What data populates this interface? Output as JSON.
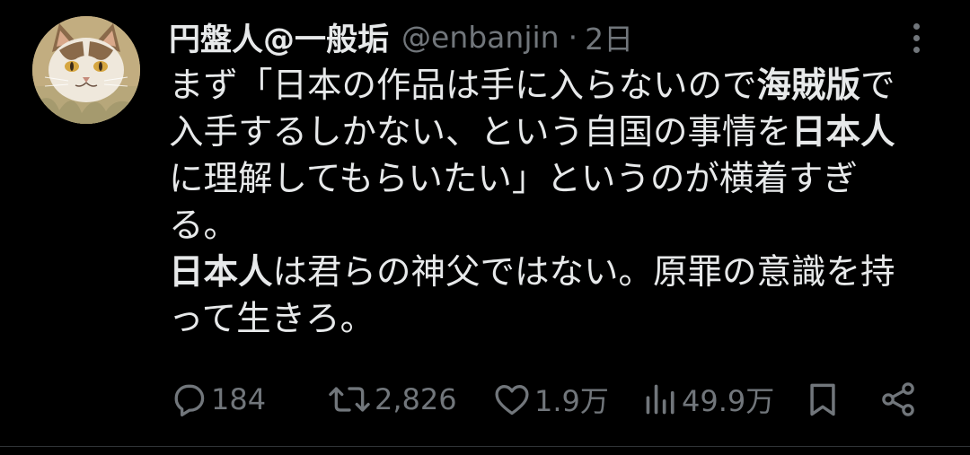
{
  "author": {
    "display_name": "円盤人@一般垢",
    "handle": "@enbanjin",
    "separator": "·",
    "time": "2日",
    "avatar_icon": "cat-avatar-icon"
  },
  "tweet": {
    "lines": [
      [
        {
          "text": "まず「日本の作品は手に入らないので",
          "bold": false
        },
        {
          "text": "海賊版",
          "bold": true
        },
        {
          "text": "で",
          "bold": false
        }
      ],
      [
        {
          "text": "入手するしかない、という自国の事情を",
          "bold": false
        },
        {
          "text": "日本人",
          "bold": true
        }
      ],
      [
        {
          "text": "に理解してもらいたい」というのが横着すぎ",
          "bold": false
        }
      ],
      [
        {
          "text": "る。",
          "bold": false
        }
      ],
      [
        {
          "text": "日本人",
          "bold": true
        },
        {
          "text": "は君らの神父ではない。原罪の意識を持",
          "bold": false
        }
      ],
      [
        {
          "text": "って生きろ。",
          "bold": false
        }
      ]
    ]
  },
  "actions": {
    "reply_count": "184",
    "retweet_count": "2,826",
    "like_count": "1.9万",
    "view_count": "49.9万"
  },
  "colors": {
    "background": "#000000",
    "text_primary": "#e7e9ea",
    "text_secondary": "#71767b",
    "divider": "#2f3336"
  }
}
